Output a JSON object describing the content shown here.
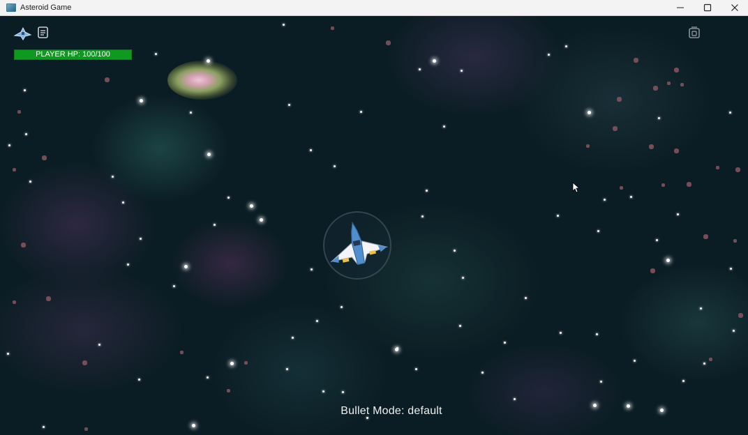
{
  "window": {
    "title": "Asteroid Game",
    "controls": [
      "minimize",
      "maximize",
      "close"
    ]
  },
  "hud": {
    "hp_label": "PLAYER HP: 100/100",
    "hp_fraction": 1.0,
    "hp_color": "#0d9a1e"
  },
  "footer": {
    "bullet_mode": "Bullet Mode: default"
  },
  "icons": {
    "app": "window-app-icon",
    "minimize": "minimize-icon",
    "maximize": "maximize-icon",
    "close": "close-icon",
    "player_ship": "ship-icon",
    "log": "document-icon",
    "inventory": "inventory-icon",
    "cursor": "mouse-cursor-icon"
  },
  "colors": {
    "background": "#0b1d24",
    "titlebar": "#f3f3f3",
    "text": "#f0f0f0"
  }
}
